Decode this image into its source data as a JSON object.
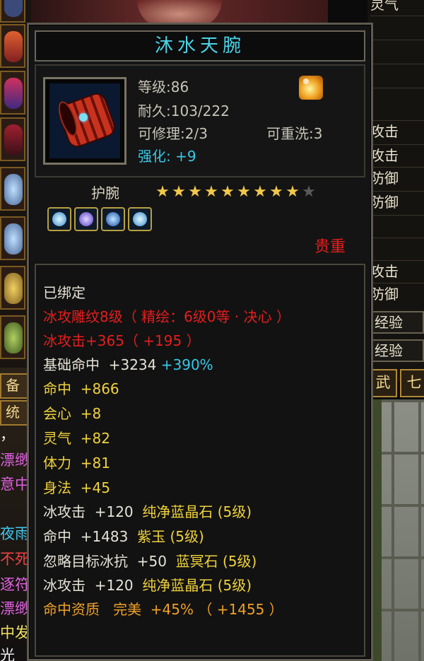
{
  "tooltip": {
    "title": "沐水天腕",
    "level_label": "等级",
    "level_value": "86",
    "durability_label": "耐久",
    "durability_value": "103/222",
    "repair_label": "可修理",
    "repair_value": "2/3",
    "rewash_label": "可重洗",
    "rewash_value": "3",
    "enhance_label": "强化",
    "enhance_value": "+9",
    "item_type": "护腕",
    "stars_filled": 9,
    "stars_total": 10,
    "quality": "贵重",
    "bound": "已绑定",
    "engrave": "冰攻雕纹8级（ 精绘：6级0等 · 决心 ）",
    "ice_attack_label": "冰攻击",
    "ice_attack_value": "+365",
    "ice_attack_bonus": "（ +195 ）",
    "base_hit_label": "基础命中",
    "base_hit_value": "+3234",
    "base_hit_pct": "+390%",
    "stats": [
      {
        "label": "命中",
        "value": "+866"
      },
      {
        "label": "会心",
        "value": "+8"
      },
      {
        "label": "灵气",
        "value": "+82"
      },
      {
        "label": "体力",
        "value": "+81"
      },
      {
        "label": "身法",
        "value": "+45"
      }
    ],
    "gems": [
      {
        "stat": "冰攻击",
        "value": "+120",
        "gem": "纯净蓝晶石 (5级)"
      },
      {
        "stat": "命中",
        "value": "+1483",
        "gem": "紫玉 (5级)"
      },
      {
        "stat": "忽略目标冰抗",
        "value": "+50",
        "gem": "蓝冥石 (5级)"
      },
      {
        "stat": "冰攻击",
        "value": "+120",
        "gem": "纯净蓝晶石 (5级)"
      }
    ],
    "aptitude_label": "命中资质",
    "aptitude_grade": "完美",
    "aptitude_pct": "+45%",
    "aptitude_bonus": "（ +1455 ）"
  },
  "right_panel": {
    "top_label": "灵气",
    "rows": [
      "攻击",
      "攻击",
      "防御",
      "防御",
      "攻击",
      "防御"
    ],
    "exp_label_1": "经验",
    "exp_label_2": "经验",
    "tab_1": "武",
    "tab_2": "七"
  },
  "left_rail": {
    "tab_1": "备",
    "tab_2": "统",
    "chat_lines": [
      "，",
      "漂缈",
      "意中",
      "夜雨",
      "不死",
      "逐符",
      "漂缈",
      "中发",
      "光"
    ]
  },
  "colors": {
    "title_cyan": "#49d3e8",
    "red": "#e41e1e",
    "yellow": "#f0d23c",
    "orange": "#f0a028",
    "white": "#e6e2d6"
  }
}
